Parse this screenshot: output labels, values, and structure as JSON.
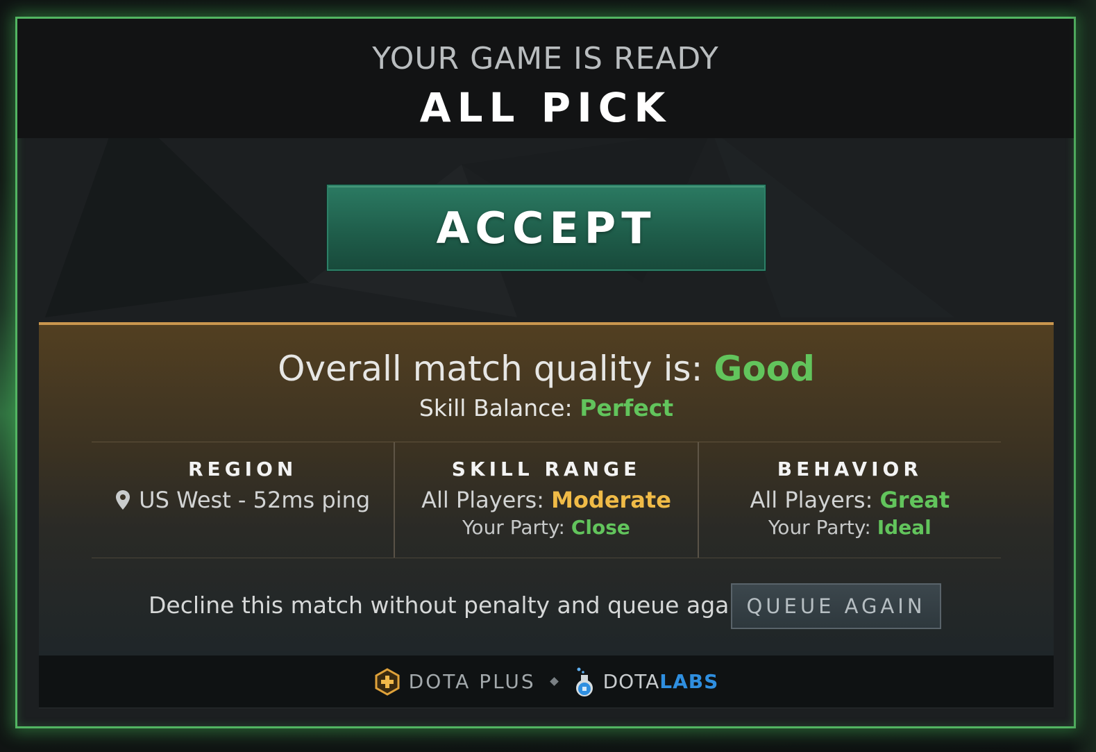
{
  "header": {
    "ready_text": "YOUR GAME IS READY",
    "mode": "ALL PICK"
  },
  "accept": {
    "label": "ACCEPT"
  },
  "quality": {
    "overall_prefix": "Overall match quality is:",
    "overall_value": "Good",
    "skill_balance_prefix": "Skill Balance:",
    "skill_balance_value": "Perfect"
  },
  "stats": {
    "region": {
      "heading": "REGION",
      "icon": "location-pin-icon",
      "value": "US West - 52ms ping"
    },
    "skill_range": {
      "heading": "SKILL RANGE",
      "all_players_prefix": "All Players:",
      "all_players_value": "Moderate",
      "party_prefix": "Your Party:",
      "party_value": "Close"
    },
    "behavior": {
      "heading": "BEHAVIOR",
      "all_players_prefix": "All Players:",
      "all_players_value": "Great",
      "party_prefix": "Your Party:",
      "party_value": "Ideal"
    }
  },
  "decline": {
    "text": "Decline this match without penalty and queue again:",
    "button_label": "QUEUE AGAIN"
  },
  "footer": {
    "dota_plus_icon": "dota-plus-hex-icon",
    "dota_plus_label": "DOTA PLUS",
    "dotalabs_icon": "flask-icon",
    "dotalabs_label_part1": "DOTA",
    "dotalabs_label_part2": "LABS"
  },
  "colors": {
    "border_glow": "#52b562",
    "accept_green": "#1f5e4b",
    "quality_good": "#62c45c",
    "skill_moderate": "#f0bb47",
    "panel_top": "#c9964e",
    "labs_blue": "#2f8fe0"
  }
}
